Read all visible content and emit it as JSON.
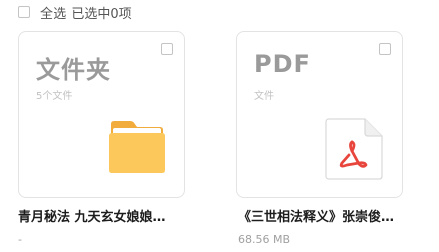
{
  "toolbar": {
    "select_all_label": "全选",
    "selected_count": "已选中0项"
  },
  "items": [
    {
      "card_title": "文件夹",
      "card_subtitle": "5个文件",
      "name": "青月秘法 九天玄女娘娘…",
      "meta": "-",
      "icon": "folder-icon",
      "icon_color": "#fbc45a"
    },
    {
      "card_title": "PDF",
      "card_subtitle": "文件",
      "name": "《三世相法释义》张崇俊…",
      "meta": "68.56 MB",
      "icon": "pdf-icon",
      "icon_color": "#e8453c"
    }
  ]
}
